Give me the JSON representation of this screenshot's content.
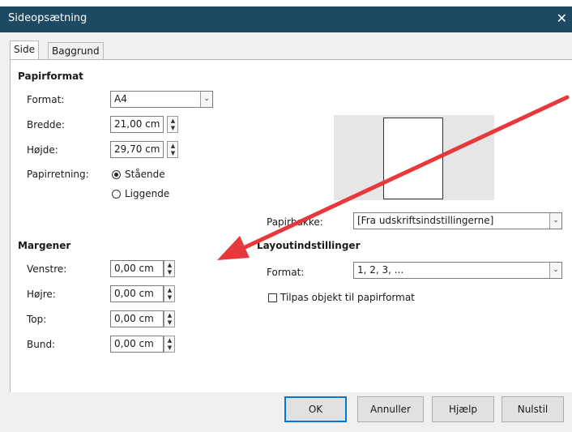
{
  "window": {
    "title": "Sideopsætning",
    "close_glyph": "✕"
  },
  "tabs": [
    {
      "label": "Side",
      "active": true
    },
    {
      "label": "Baggrund",
      "active": false
    }
  ],
  "paper_format": {
    "heading": "Papirformat",
    "format_label": "Format:",
    "format_value": "A4",
    "width_label": "Bredde:",
    "width_value": "21,00 cm",
    "height_label": "Højde:",
    "height_value": "29,70 cm",
    "orientation_label": "Papirretning:",
    "portrait_label": "Stående",
    "landscape_label": "Liggende",
    "orientation_selected": "portrait"
  },
  "paper_tray": {
    "label": "Papirbakke:",
    "value": "[Fra udskriftsindstillingerne]"
  },
  "margins": {
    "heading": "Margener",
    "left_label": "Venstre:",
    "left_value": "0,00 cm",
    "right_label": "Højre:",
    "right_value": "0,00 cm",
    "top_label": "Top:",
    "top_value": "0,00 cm",
    "bottom_label": "Bund:",
    "bottom_value": "0,00 cm"
  },
  "layout_settings": {
    "heading": "Layoutindstillinger",
    "format_label": "Format:",
    "format_value": "1, 2, 3, ...",
    "fit_label": "Tilpas objekt til papirformat",
    "fit_checked": false
  },
  "buttons": {
    "ok": "OK",
    "cancel": "Annuller",
    "help": "Hjælp",
    "reset": "Nulstil"
  },
  "colors": {
    "titlebar": "#1c4a63",
    "annotation_arrow": "#e8383b",
    "default_button_border": "#0078d7"
  },
  "icons": {
    "spin_up": "▲",
    "spin_down": "▼",
    "dropdown": "⌄"
  }
}
